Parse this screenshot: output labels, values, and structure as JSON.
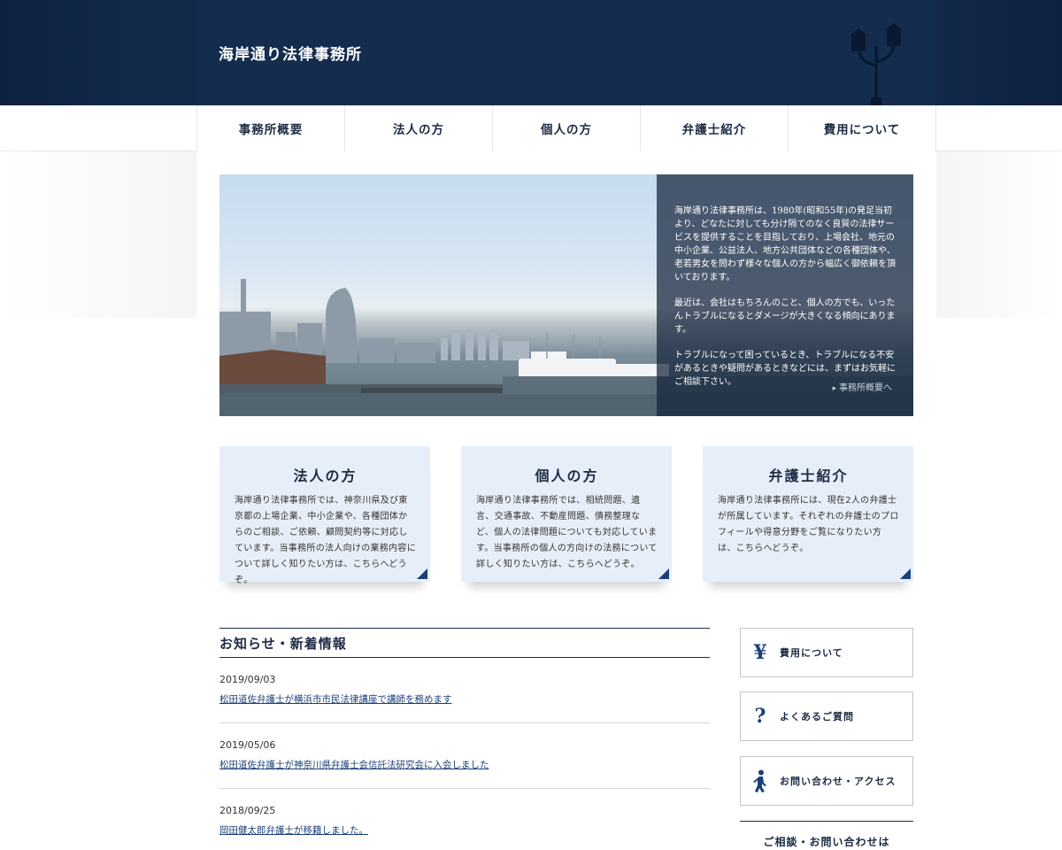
{
  "header": {
    "site_title": "海岸通り法律事務所"
  },
  "nav": {
    "items": [
      {
        "label": "事務所概要"
      },
      {
        "label": "法人の方"
      },
      {
        "label": "個人の方"
      },
      {
        "label": "弁護士紹介"
      },
      {
        "label": "費用について"
      }
    ]
  },
  "hero": {
    "paragraphs": [
      "海岸通り法律事務所は、1980年(昭和55年)の発足当初より、どなたに対しても分け隔てのなく良質の法律サービスを提供することを目指しており、上場会社、地元の中小企業、公益法人、地方公共団体などの各種団体や、老若男女を問わず様々な個人の方から幅広く御依頼を頂いております。",
      "最近は、会社はもちろんのこと、個人の方でも、いったんトラブルになるとダメージが大きくなる傾向にあります。",
      "トラブルになって困っているとき、トラブルになる不安があるときや疑問があるときなどには、まずはお気軽にご相談下さい。"
    ],
    "link_label": "事務所概要へ"
  },
  "cards": [
    {
      "title": "法人の方",
      "body": "海岸通り法律事務所では、神奈川県及び東京都の上場企業、中小企業や、各種団体からのご相談、ご依頼、顧問契約等に対応しています。当事務所の法人向けの業務内容について詳しく知りたい方は、こちらへどうぞ。"
    },
    {
      "title": "個人の方",
      "body": "海岸通り法律事務所では、相続問題、遺言、交通事故、不動産問題、債務整理など、個人の法律問題についても対応しています。当事務所の個人の方向けの法務について詳しく知りたい方は、こちらへどうぞ。"
    },
    {
      "title": "弁護士紹介",
      "body": "海岸通り法律事務所には、現在2人の弁護士が所属しています。それぞれの弁護士のプロフィールや得意分野をご覧になりたい方は、こちらへどうぞ。"
    }
  ],
  "news": {
    "heading": "お知らせ・新着情報",
    "items": [
      {
        "date": "2019/09/03",
        "title": "松田道佐弁護士が横浜市市民法律講座で講師を務めます"
      },
      {
        "date": "2019/05/06",
        "title": "松田道佐弁護士が神奈川県弁護士会信託法研究会に入会しました"
      },
      {
        "date": "2018/09/25",
        "title": "岡田健太郎弁護士が移籍しました。"
      }
    ]
  },
  "sidebar": {
    "buttons": [
      {
        "icon_text": "¥",
        "icon": "yen-icon",
        "label": "費用について"
      },
      {
        "icon_text": "?",
        "icon": "question-icon",
        "label": "よくあるご質問"
      },
      {
        "icon": "walking-person-icon",
        "label": "お問い合わせ・アクセス"
      }
    ],
    "contact_heading": "ご相談・お問い合わせは"
  },
  "colors": {
    "header_bg": "#142c4e",
    "accent": "#1b3f7a",
    "card_bg": "#e6eff9",
    "text_dark": "#1d2b44"
  }
}
